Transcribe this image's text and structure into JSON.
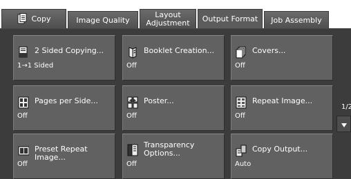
{
  "tabs": [
    {
      "label": "Copy",
      "icon": "copy-icon"
    },
    {
      "label": "Image Quality"
    },
    {
      "label": "Layout\nAdjustment"
    },
    {
      "label": "Output Format",
      "active": true
    },
    {
      "label": "Job Assembly"
    }
  ],
  "buttons": [
    {
      "label": "2 Sided Copying...",
      "value": "1→1 Sided",
      "icon": "two-sided-icon"
    },
    {
      "label": "Booklet Creation...",
      "value": "Off",
      "icon": "booklet-icon"
    },
    {
      "label": "Covers...",
      "value": "Off",
      "icon": "covers-icon"
    },
    {
      "label": "Pages per Side...",
      "value": "Off",
      "icon": "pages-per-side-icon"
    },
    {
      "label": "Poster...",
      "value": "Off",
      "icon": "poster-icon"
    },
    {
      "label": "Repeat Image...",
      "value": "Off",
      "icon": "repeat-image-icon"
    },
    {
      "label": "Preset Repeat Image...",
      "value": "Off",
      "icon": "preset-repeat-icon"
    },
    {
      "label": "Transparency\nOptions...",
      "value": "Off",
      "icon": "transparency-icon"
    },
    {
      "label": "Copy Output...",
      "value": "Auto",
      "icon": "copy-output-icon"
    }
  ],
  "pager": "1/2",
  "colors": {
    "tab": "#5c5c5c",
    "button": "#616161",
    "background": "#3c3c3c"
  }
}
